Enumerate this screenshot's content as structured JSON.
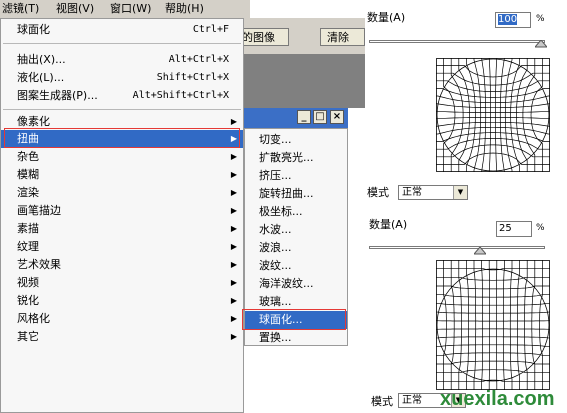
{
  "menubar": {
    "items": [
      "滤镜(T)",
      "视图(V)",
      "窗口(W)",
      "帮助(H)"
    ]
  },
  "toolbar": {
    "btn1": "的图像",
    "btn2": "清除"
  },
  "window_controls": {
    "min": "_",
    "max": "□",
    "close": "×"
  },
  "menu": {
    "items": [
      {
        "label": "球面化",
        "shortcut": "Ctrl+F"
      },
      {
        "label": "抽出(X)...",
        "shortcut": "Alt+Ctrl+X"
      },
      {
        "label": "液化(L)...",
        "shortcut": "Shift+Ctrl+X"
      },
      {
        "label": "图案生成器(P)...",
        "shortcut": "Alt+Shift+Ctrl+X"
      },
      {
        "label": "像素化"
      },
      {
        "label": "扭曲"
      },
      {
        "label": "杂色"
      },
      {
        "label": "模糊"
      },
      {
        "label": "渲染"
      },
      {
        "label": "画笔描边"
      },
      {
        "label": "素描"
      },
      {
        "label": "纹理"
      },
      {
        "label": "艺术效果"
      },
      {
        "label": "视频"
      },
      {
        "label": "锐化"
      },
      {
        "label": "风格化"
      },
      {
        "label": "其它"
      }
    ]
  },
  "submenu": {
    "items": [
      "切变...",
      "扩散亮光...",
      "挤压...",
      "旋转扭曲...",
      "极坐标...",
      "水波...",
      "波浪...",
      "波纹...",
      "海洋波纹...",
      "玻璃...",
      "球面化...",
      "置换..."
    ]
  },
  "dialog1": {
    "amount_label": "数量(A)",
    "amount_value": "100",
    "unit": "%",
    "mode_label": "模式",
    "mode_value": "正常",
    "slider_value": 100
  },
  "dialog2": {
    "amount_label": "数量(A)",
    "amount_value": "25",
    "unit": "%",
    "mode_label": "模式",
    "mode_value": "正常",
    "slider_value": 25
  },
  "watermark": "xuexila.com",
  "colors": {
    "highlight": "#316ac5",
    "redbox": "#e53935",
    "watermark": "#2e8b3a"
  }
}
